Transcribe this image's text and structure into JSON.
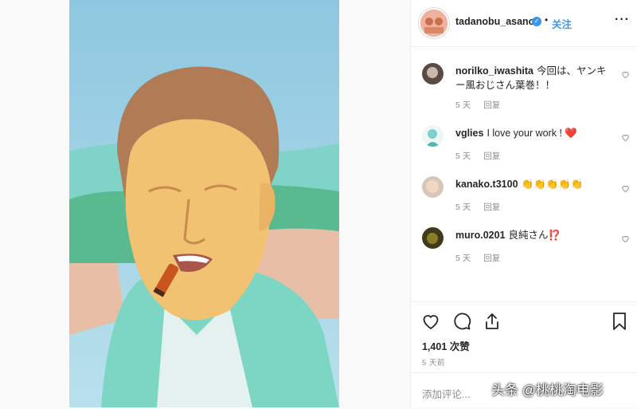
{
  "post": {
    "author": {
      "username": "tadanobu_asano",
      "verified_icon": "verified-badge-icon",
      "follow_separator": "•",
      "follow_label": "关注"
    },
    "more_label": "···",
    "comments": [
      {
        "username": "norilko_iwashita",
        "text": "今回は、ヤンキー風おじさん葉巻！！",
        "age": "5 天",
        "reply": "回复"
      },
      {
        "username": "vglies",
        "text": "I love your work ! ❤️",
        "age": "5 天",
        "reply": "回复"
      },
      {
        "username": "kanako.t3100",
        "text": "👏👏👏👏👏",
        "age": "5 天",
        "reply": "回复"
      },
      {
        "username": "muro.0201",
        "text": "良純さん⁉️",
        "age": "5 天",
        "reply": "回复"
      }
    ],
    "likes": "1,401 次赞",
    "posted_ago": "5 天前",
    "comment_placeholder": "添加评论..."
  },
  "watermark": "头条 @桃桃淘电影",
  "colors": {
    "accent": "#3897f0",
    "muted": "#8e8e8e",
    "text": "#262626"
  }
}
